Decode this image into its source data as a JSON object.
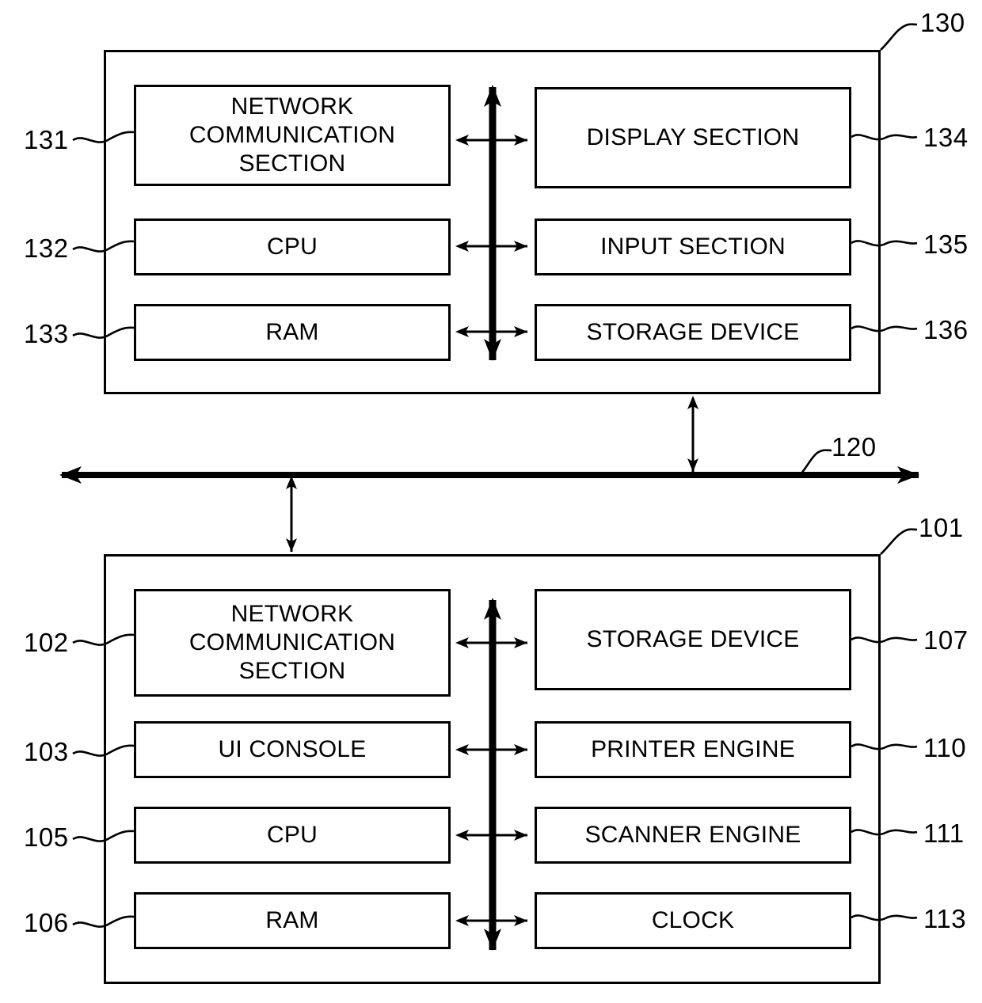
{
  "figure": {
    "type": "block-diagram",
    "background_color": "#ffffff",
    "line_color": "#000000"
  },
  "network": {
    "ref": "120",
    "name": "network-bus"
  },
  "units": [
    {
      "ref": "130",
      "name": "host-computer-unit",
      "bus_name": "internal-bus",
      "left_column": [
        {
          "ref": "131",
          "label": "NETWORK\nCOMMUNICATION\nSECTION",
          "name": "network-communication-section"
        },
        {
          "ref": "132",
          "label": "CPU",
          "name": "cpu"
        },
        {
          "ref": "133",
          "label": "RAM",
          "name": "ram"
        }
      ],
      "right_column": [
        {
          "ref": "134",
          "label": "DISPLAY SECTION",
          "name": "display-section"
        },
        {
          "ref": "135",
          "label": "INPUT SECTION",
          "name": "input-section"
        },
        {
          "ref": "136",
          "label": "STORAGE DEVICE",
          "name": "storage-device"
        }
      ]
    },
    {
      "ref": "101",
      "name": "image-forming-apparatus-unit",
      "bus_name": "internal-bus",
      "left_column": [
        {
          "ref": "102",
          "label": "NETWORK\nCOMMUNICATION\nSECTION",
          "name": "network-communication-section"
        },
        {
          "ref": "103",
          "label": "UI CONSOLE",
          "name": "ui-console"
        },
        {
          "ref": "105",
          "label": "CPU",
          "name": "cpu"
        },
        {
          "ref": "106",
          "label": "RAM",
          "name": "ram"
        }
      ],
      "right_column": [
        {
          "ref": "107",
          "label": "STORAGE DEVICE",
          "name": "storage-device"
        },
        {
          "ref": "110",
          "label": "PRINTER ENGINE",
          "name": "printer-engine"
        },
        {
          "ref": "111",
          "label": "SCANNER ENGINE",
          "name": "scanner-engine"
        },
        {
          "ref": "113",
          "label": "CLOCK",
          "name": "clock"
        }
      ]
    }
  ]
}
